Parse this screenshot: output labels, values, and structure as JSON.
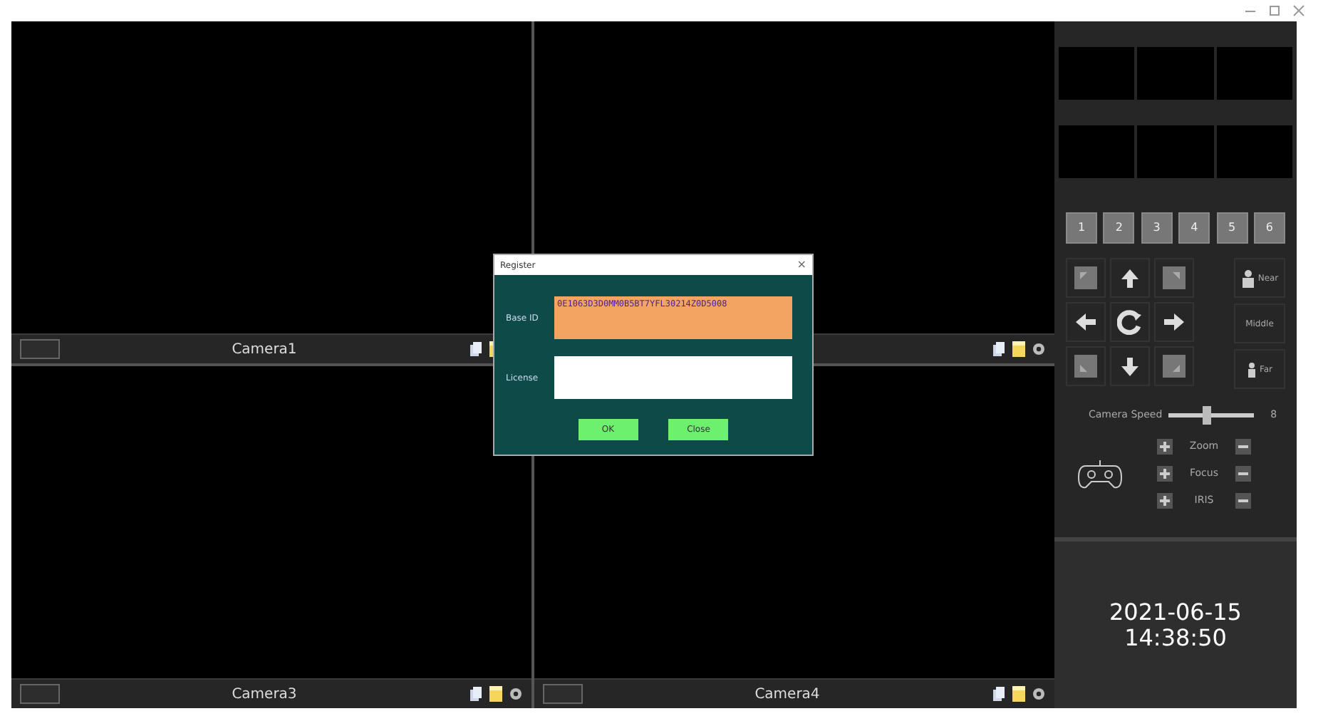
{
  "cameras": [
    {
      "kind": "view",
      "name": "Camera1"
    },
    {
      "kind": "view"
    },
    {
      "kind": "view",
      "name": "Camera3"
    },
    {
      "kind": "view",
      "name": "Camera4"
    }
  ],
  "presets": [
    "1",
    "2",
    "3",
    "4",
    "5",
    "6"
  ],
  "ptz": [
    {
      "kind": "diag"
    },
    {
      "kind": "arrow"
    },
    {
      "kind": "diag"
    },
    {
      "kind": "arrow"
    },
    {
      "kind": "reset"
    },
    {
      "kind": "arrow"
    },
    {
      "kind": "diag"
    },
    {
      "kind": "arrow"
    },
    {
      "kind": "diag"
    }
  ],
  "distance": [
    {
      "label": "Near",
      "kind": "tall"
    },
    {
      "label": "Middle",
      "kind": "plain"
    },
    {
      "label": "Far",
      "kind": "short"
    }
  ],
  "speed": {
    "label": "Camera Speed",
    "level": 0.45,
    "reading": "8"
  },
  "lens": [
    "Zoom",
    "Focus",
    "IRIS"
  ],
  "clock": {
    "date": "2021-06-15",
    "time": "14:38:50"
  },
  "dialog": {
    "title": "Register",
    "close": "×",
    "fields": [
      {
        "label": "Base ID",
        "value": "0E1063D3D0MM0B5BT7YFL30214Z0D5008",
        "kind": "readonly"
      },
      {
        "label": "License",
        "kind": "input"
      }
    ],
    "buttons": [
      "OK",
      "Close"
    ]
  }
}
